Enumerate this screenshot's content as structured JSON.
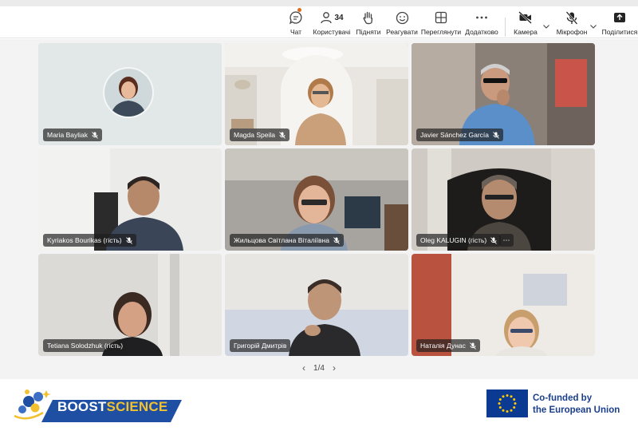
{
  "toolbar": {
    "chat_label": "Чат",
    "people_label": "Користувачі",
    "people_count": "34",
    "raise_label": "Підняти",
    "react_label": "Реагувати",
    "view_label": "Переглянути",
    "more_label": "Додатково",
    "camera_label": "Камера",
    "mic_label": "Мікрофон",
    "share_label": "Поділитися"
  },
  "participants": [
    {
      "name": "Maria Bayliak"
    },
    {
      "name": "Magda Speila"
    },
    {
      "name": "Javier Sánchez García"
    },
    {
      "name": "Kyriakos Bourikas (гість)"
    },
    {
      "name": "Жильцова Світлана Віталіївна"
    },
    {
      "name": "Oleg KALUGIN (гість)"
    },
    {
      "name": "Tetiana Solodzhuk (гість)"
    },
    {
      "name": "Григорій Дмитрів"
    },
    {
      "name": "Наталія Дунас"
    }
  ],
  "pager": {
    "label": "1/4"
  },
  "footer": {
    "boost_part1": "BOOST",
    "boost_part2": "SCIENCE",
    "eu_line1": "Co-funded by",
    "eu_line2": "the European Union"
  },
  "colors": {
    "accent": "#6264a7",
    "eu_blue": "#1a3f8c",
    "boost_yellow": "#f2c12e"
  }
}
